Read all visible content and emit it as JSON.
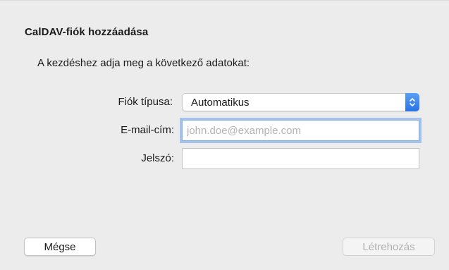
{
  "dialog": {
    "title": "CalDAV-fiók hozzáadása",
    "subtitle": "A kezdéshez adja meg a következő adatokat:"
  },
  "form": {
    "account_type": {
      "label": "Fiók típusa:",
      "value": "Automatikus",
      "icon": "updown-chevron-icon"
    },
    "email": {
      "label": "E-mail-cím:",
      "value": "",
      "placeholder": "john.doe@example.com"
    },
    "password": {
      "label": "Jelszó:",
      "value": ""
    }
  },
  "buttons": {
    "cancel_label": "Mégse",
    "create_label": "Létrehozás"
  },
  "colors": {
    "accent": "#2a72e8",
    "focus_ring": "#7fb0ee",
    "background": "#ececec"
  }
}
